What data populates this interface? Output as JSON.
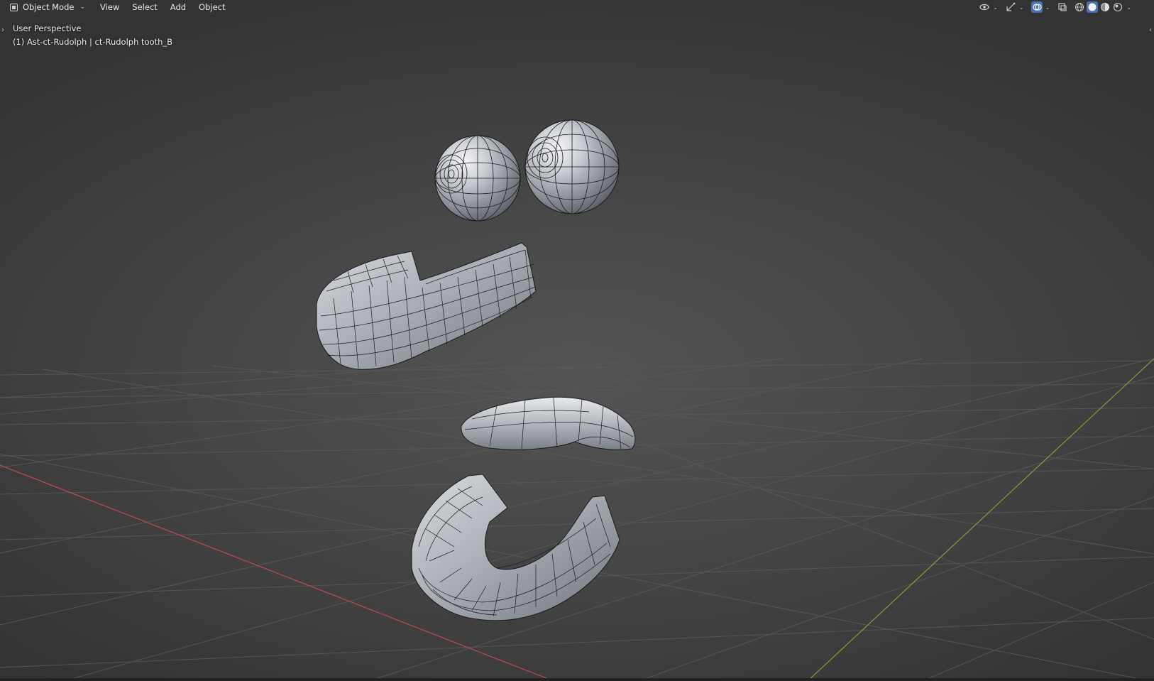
{
  "header": {
    "mode_label": "Object Mode",
    "menus": [
      "View",
      "Select",
      "Add",
      "Object"
    ]
  },
  "overlay": {
    "view_name": "User Perspective",
    "object_path": "(1) Ast-ct-Rudolph | ct-Rudolph tooth_B"
  },
  "toolbar_icons": [
    "visibility-eye-icon",
    "gizmo-icon",
    "overlays-icon",
    "xray-icon",
    "wireframe-shading-icon",
    "solid-shading-icon",
    "material-shading-icon",
    "rendered-shading-icon"
  ],
  "colors": {
    "accent": "#4772b3",
    "x_axis": "#b24a4f",
    "y_axis": "#7a9a3a",
    "mesh_fill": "#9aa0a8"
  }
}
